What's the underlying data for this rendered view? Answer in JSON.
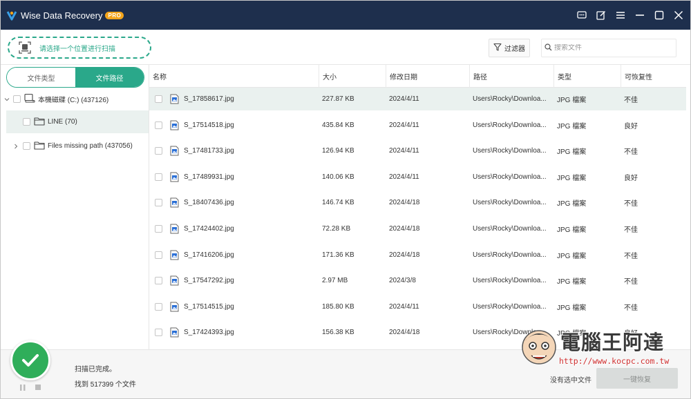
{
  "app": {
    "title": "Wise Data Recovery",
    "badge": "PRO",
    "colors": {
      "titlebar": "#1e2f4d",
      "accent": "#2aa88a",
      "badge": "#f3a51c",
      "success": "#2fae5a",
      "row_highlight": "#eaf1ef"
    },
    "title_controls": [
      "feedback-icon",
      "edit-icon",
      "menu-icon",
      "minimize-icon",
      "maximize-icon",
      "close-icon"
    ]
  },
  "toolbar": {
    "scan_location_label": "请选择一个位置进行扫描",
    "filter_label": "过滤器",
    "search_placeholder": "搜索文件"
  },
  "left_tabs": {
    "file_type": "文件类型",
    "file_path": "文件路径",
    "active": "file_path"
  },
  "tree": [
    {
      "label": "本機磁碟 (C:) (437126)",
      "icon": "drive-icon",
      "expanded": true
    },
    {
      "label": "LINE (70)",
      "icon": "folder-icon",
      "selected": true
    },
    {
      "label": "Files missing path (437056)",
      "icon": "folder-icon",
      "expanded": false
    }
  ],
  "table": {
    "columns": [
      "名称",
      "大小",
      "修改日期",
      "路径",
      "类型",
      "可恢复性"
    ],
    "rows": [
      {
        "name": "S_17858617.jpg",
        "size": "227.87 KB",
        "date": "2024/4/11",
        "path": "Users\\Rocky\\Downloa...",
        "type": "JPG 檔案",
        "recoverability": "不佳",
        "highlighted": true
      },
      {
        "name": "S_17514518.jpg",
        "size": "435.84 KB",
        "date": "2024/4/11",
        "path": "Users\\Rocky\\Downloa...",
        "type": "JPG 檔案",
        "recoverability": "良好"
      },
      {
        "name": "S_17481733.jpg",
        "size": "126.94 KB",
        "date": "2024/4/11",
        "path": "Users\\Rocky\\Downloa...",
        "type": "JPG 檔案",
        "recoverability": "不佳"
      },
      {
        "name": "S_17489931.jpg",
        "size": "140.06 KB",
        "date": "2024/4/11",
        "path": "Users\\Rocky\\Downloa...",
        "type": "JPG 檔案",
        "recoverability": "良好"
      },
      {
        "name": "S_18407436.jpg",
        "size": "146.74 KB",
        "date": "2024/4/18",
        "path": "Users\\Rocky\\Downloa...",
        "type": "JPG 檔案",
        "recoverability": "不佳"
      },
      {
        "name": "S_17424402.jpg",
        "size": "72.28 KB",
        "date": "2024/4/18",
        "path": "Users\\Rocky\\Downloa...",
        "type": "JPG 檔案",
        "recoverability": "不佳"
      },
      {
        "name": "S_17416206.jpg",
        "size": "171.36 KB",
        "date": "2024/4/18",
        "path": "Users\\Rocky\\Downloa...",
        "type": "JPG 檔案",
        "recoverability": "不佳"
      },
      {
        "name": "S_17547292.jpg",
        "size": "2.97 MB",
        "date": "2024/3/8",
        "path": "Users\\Rocky\\Downloa...",
        "type": "JPG 檔案",
        "recoverability": "不佳"
      },
      {
        "name": "S_17514515.jpg",
        "size": "185.80 KB",
        "date": "2024/4/11",
        "path": "Users\\Rocky\\Downloa...",
        "type": "JPG 檔案",
        "recoverability": "不佳"
      },
      {
        "name": "S_17424393.jpg",
        "size": "156.38 KB",
        "date": "2024/4/18",
        "path": "Users\\Rocky\\Downloa...",
        "type": "JPG 檔案",
        "recoverability": "良好"
      }
    ]
  },
  "status": {
    "scan_done": "扫描已完成。",
    "found": "找到 517399 个文件",
    "nothing_selected": "没有选中文件",
    "recover_button": "一键恢复"
  },
  "watermark": {
    "text": "電腦王阿達",
    "url": "http://www.kocpc.com.tw"
  }
}
